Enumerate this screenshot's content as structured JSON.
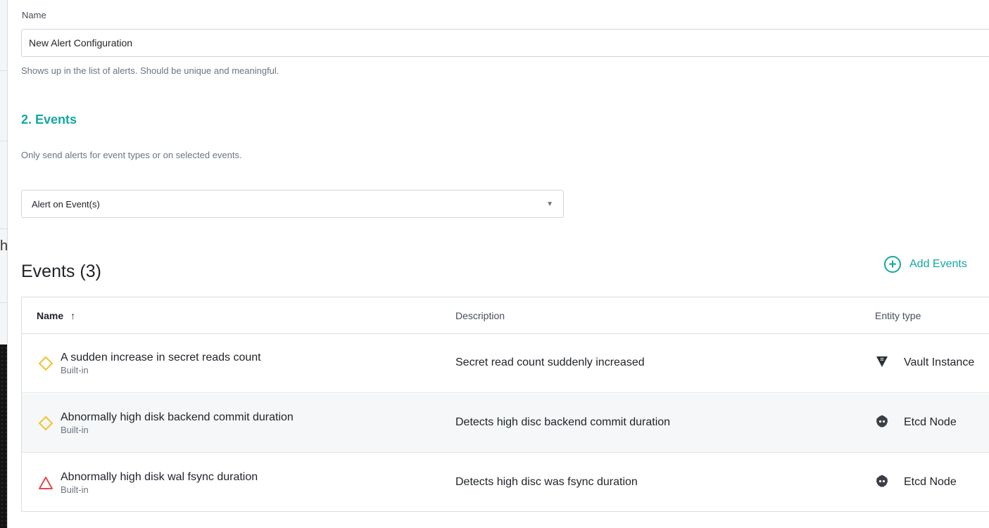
{
  "form": {
    "name_label": "Name",
    "name_value": "New Alert Configuration",
    "name_helper": "Shows up in the list of alerts. Should be unique and meaningful."
  },
  "events_section": {
    "title": "2. Events",
    "description": "Only send alerts for event types or on selected events.",
    "select_value": "Alert on Event(s)"
  },
  "events_table": {
    "heading": "Events (3)",
    "add_label": "Add Events",
    "columns": {
      "name": "Name",
      "description": "Description",
      "entity": "Entity type"
    },
    "sort_arrow": "↑",
    "rows": [
      {
        "name": "A sudden increase in secret reads count",
        "source": "Built-in",
        "description": "Secret read count suddenly increased",
        "entity": "Vault Instance",
        "severity_icon": "warning-diamond-icon",
        "entity_icon": "vault-icon"
      },
      {
        "name": "Abnormally high disk backend commit duration",
        "source": "Built-in",
        "description": "Detects high disc backend commit duration",
        "entity": "Etcd Node",
        "severity_icon": "warning-diamond-icon",
        "entity_icon": "etcd-icon"
      },
      {
        "name": "Abnormally high disk wal fsync duration",
        "source": "Built-in",
        "description": "Detects high disc was fsync duration",
        "entity": "Etcd Node",
        "severity_icon": "critical-triangle-icon",
        "entity_icon": "etcd-icon"
      }
    ]
  },
  "behind_page": {
    "partial_char": "h"
  },
  "colors": {
    "accent": "#14a8a2",
    "warning": "#f2c230",
    "critical": "#e5484d",
    "text": "#1f2328",
    "muted": "#6b7580"
  }
}
